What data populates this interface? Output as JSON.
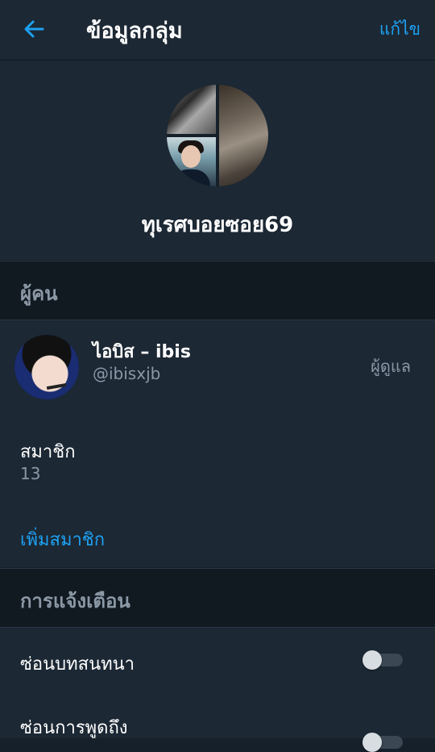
{
  "header": {
    "title": "ข้อมูลกลุ่ม",
    "edit_label": "แก้ไข"
  },
  "group": {
    "name": "ทุเรศบอยซอย69"
  },
  "people_section": {
    "header": "ผู้คน",
    "member": {
      "name": "ไอบิส – ibis",
      "handle": "@ibisxjb",
      "role": "ผู้ดูแล"
    },
    "members_label": "สมาชิก",
    "members_count": "13",
    "add_member_label": "เพิ่มสมาชิก"
  },
  "notifications_section": {
    "header": "การแจ้งเตือน",
    "settings": [
      {
        "label": "ซ่อนบทสนทนา",
        "enabled": false
      },
      {
        "label": "ซ่อนการพูดถึง",
        "enabled": false
      }
    ]
  },
  "colors": {
    "accent": "#1da1f2",
    "background": "#1c2834",
    "section_header": "#111921",
    "secondary_text": "#8b98a5"
  },
  "icons": {
    "back": "back-arrow-icon"
  }
}
